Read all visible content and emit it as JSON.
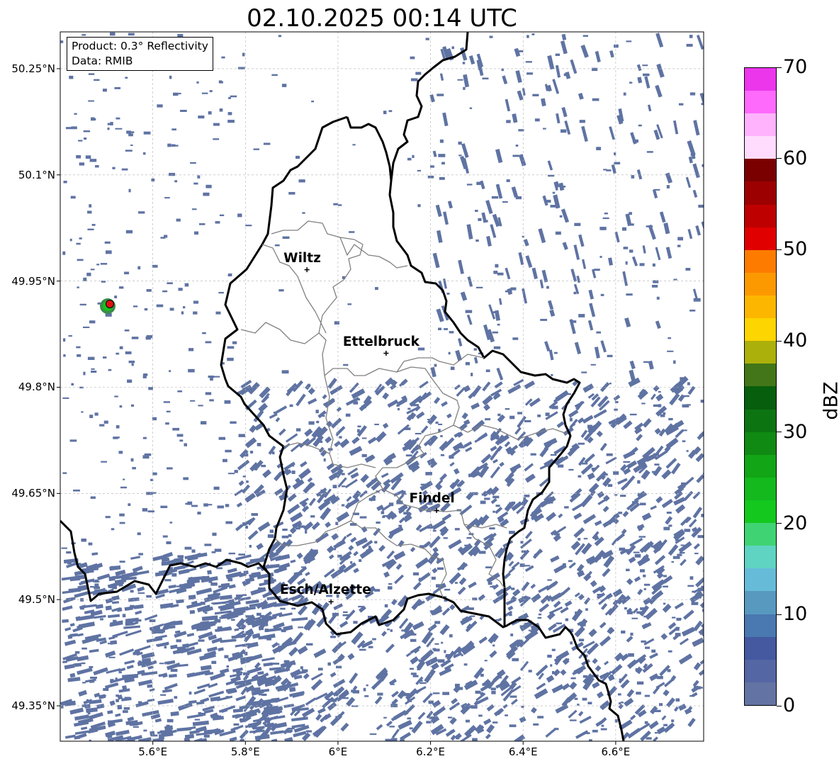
{
  "title": "02.10.2025 00:14 UTC",
  "info_box": {
    "product": "Product: 0.3° Reflectivity",
    "data": "Data: RMIB"
  },
  "axes": {
    "y_ticks": [
      "50.25°N",
      "50.1°N",
      "49.95°N",
      "49.8°N",
      "49.65°N",
      "49.5°N",
      "49.35°N"
    ],
    "x_ticks": [
      "5.6°E",
      "5.8°E",
      "6°E",
      "6.2°E",
      "6.4°E",
      "6.6°E"
    ],
    "lon_range": [
      5.4,
      6.79
    ],
    "lat_range": [
      49.3,
      50.302
    ],
    "grid": true
  },
  "cities": [
    {
      "name": "Wiltz",
      "lon": 5.933,
      "lat": 49.966
    },
    {
      "name": "Ettelbruck",
      "lon": 6.104,
      "lat": 49.848
    },
    {
      "name": "Findel",
      "lon": 6.213,
      "lat": 49.626
    },
    {
      "name": "Esch/Alzette",
      "lon": 5.985,
      "lat": 49.497
    }
  ],
  "radar_site": {
    "lon": 5.505,
    "lat": 49.914
  },
  "colorbar": {
    "title": "dBZ",
    "min": 0,
    "max": 70,
    "tick_labels": [
      "0",
      "10",
      "20",
      "30",
      "40",
      "50",
      "60",
      "70"
    ],
    "colors": [
      "#6373a3",
      "#5466a3",
      "#4459a0",
      "#4a78b0",
      "#5899c0",
      "#66bcd8",
      "#5fd4c2",
      "#40d373",
      "#14c81e",
      "#14b91e",
      "#12a516",
      "#108a12",
      "#0d7412",
      "#075e0c",
      "#437618",
      "#acb00a",
      "#fdd500",
      "#fdb600",
      "#fd9900",
      "#fd7c00",
      "#e00000",
      "#be0000",
      "#9c0000",
      "#7a0000",
      "#ffdcfd",
      "#ffb3fd",
      "#fe6afc",
      "#eb36eb"
    ]
  },
  "colors": {
    "echo": "#5f73a3",
    "border_national": "#000000",
    "border_canton": "#808080",
    "grid": "#b0b0b0"
  }
}
